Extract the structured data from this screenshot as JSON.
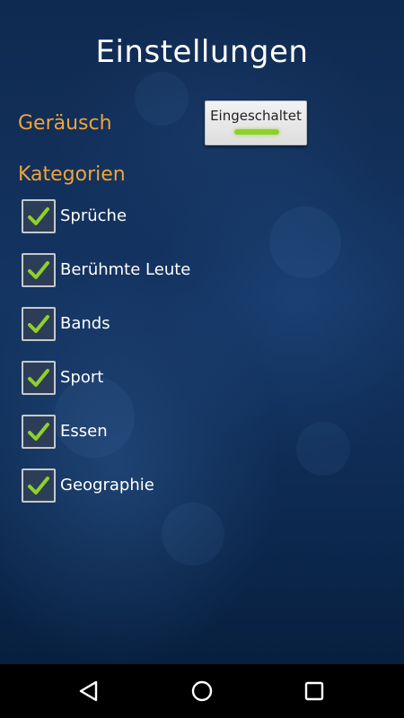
{
  "header": {
    "title": "Einstellungen"
  },
  "sound": {
    "label": "Geräusch",
    "button_label": "Eingeschaltet",
    "indicator_color": "#8fd12a"
  },
  "categories": {
    "label": "Kategorien",
    "items": [
      {
        "label": "Sprüche",
        "checked": true
      },
      {
        "label": "Berühmte Leute",
        "checked": true
      },
      {
        "label": "Bands",
        "checked": true
      },
      {
        "label": "Sport",
        "checked": true
      },
      {
        "label": "Essen",
        "checked": true
      },
      {
        "label": "Geographie",
        "checked": true
      }
    ]
  },
  "colors": {
    "section_label": "#f0a43a",
    "check_mark": "#8fd12a",
    "background": "#0f2a50"
  },
  "navigation": {
    "icons": [
      "back-icon",
      "home-icon",
      "recents-icon"
    ]
  }
}
